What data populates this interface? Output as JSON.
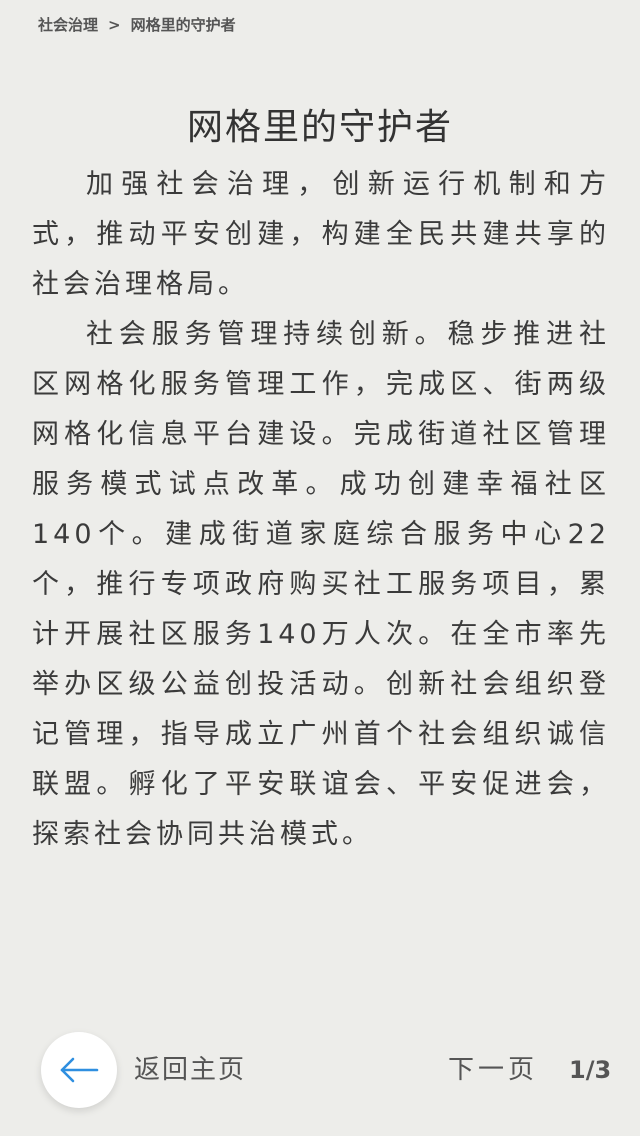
{
  "breadcrumb": {
    "parent": "社会治理",
    "separator": ">",
    "current": "网格里的守护者"
  },
  "page": {
    "title": "网格里的守护者"
  },
  "article": {
    "paragraphs": [
      "加强社会治理，创新运行机制和方式，推动平安创建，构建全民共建共享的社会治理格局。",
      "社会服务管理持续创新。稳步推进社区网格化服务管理工作，完成区、街两级网格化信息平台建设。完成街道社区管理服务模式试点改革。成功创建幸福社区140个。建成街道家庭综合服务中心22个，推行专项政府购买社工服务项目，累计开展社区服务140万人次。在全市率先举办区级公益创投活动。创新社会组织登记管理，指导成立广州首个社会组织诚信联盟。孵化了平安联谊会、平安促进会，探索社会协同共治模式。"
    ]
  },
  "footer": {
    "back_icon": "arrow-left-icon",
    "back_icon_color": "#2f8fe0",
    "back_label": "返回主页",
    "next_label": "下一页",
    "page_indicator": "1/3"
  }
}
